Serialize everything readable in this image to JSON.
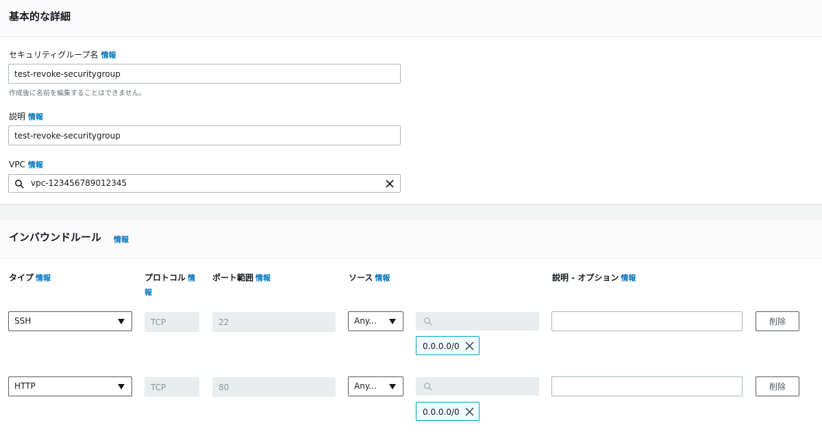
{
  "info_label": "情報",
  "basic": {
    "title": "基本的な詳細",
    "sg_name_label": "セキュリティグループ名",
    "sg_name_value": "test-revoke-securitygroup",
    "sg_name_hint": "作成後に名前を編集することはできません。",
    "desc_label": "説明",
    "desc_value": "test-revoke-securitygroup",
    "vpc_label": "VPC",
    "vpc_value": "vpc-123456789012345"
  },
  "inbound": {
    "title": "インバウンドルール",
    "columns": {
      "type": "タイプ",
      "protocol": "プロトコル",
      "port": "ポート範囲",
      "source": "ソース",
      "description": "説明 - オプション"
    },
    "rules": [
      {
        "type": "SSH",
        "protocol": "TCP",
        "port": "22",
        "source": "Any...",
        "cidr": "0.0.0.0/0",
        "description": "",
        "delete_label": "削除"
      },
      {
        "type": "HTTP",
        "protocol": "TCP",
        "port": "80",
        "source": "Any...",
        "cidr": "0.0.0.0/0",
        "description": "",
        "delete_label": "削除"
      }
    ]
  },
  "colors": {
    "link": "#0073bb",
    "token_border": "#00a1c9",
    "disabled_bg": "#eaeded"
  },
  "icons": [
    "search-icon",
    "clear-icon",
    "caret-down-icon",
    "remove-token-icon"
  ]
}
